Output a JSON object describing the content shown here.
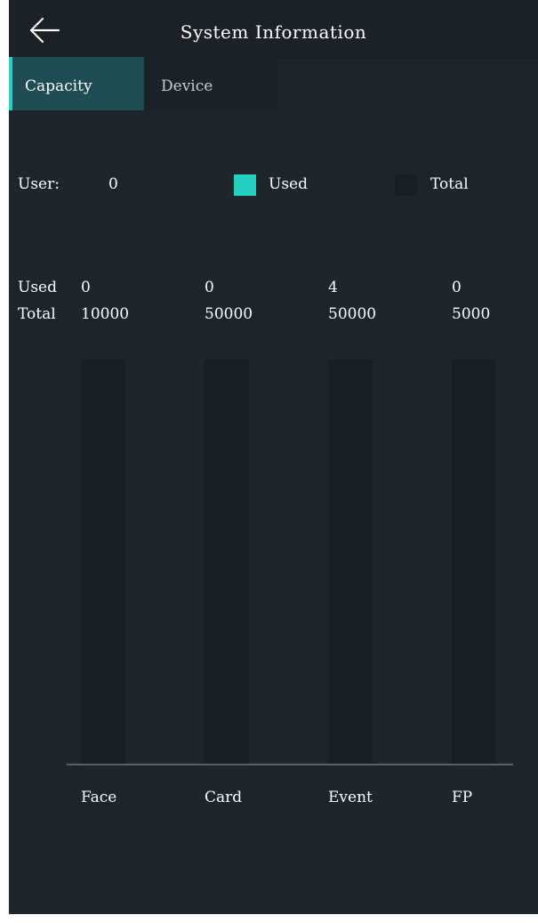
{
  "header": {
    "title": "System Information",
    "back_icon": "arrow-left-icon"
  },
  "tabs": [
    {
      "label": "Capacity",
      "active": true
    },
    {
      "label": "Device",
      "active": false
    }
  ],
  "user": {
    "label": "User:",
    "value": "0"
  },
  "legend": [
    {
      "label": "Used",
      "color": "#25d0c3"
    },
    {
      "label": "Total",
      "color": "#1a1f25"
    }
  ],
  "table": {
    "row_labels": {
      "used": "Used",
      "total": "Total"
    },
    "columns": [
      {
        "used": "0",
        "total": "10000"
      },
      {
        "used": "0",
        "total": "50000"
      },
      {
        "used": "4",
        "total": "50000"
      },
      {
        "used": "0",
        "total": "5000"
      }
    ]
  },
  "chart_data": {
    "type": "bar",
    "categories": [
      "Face",
      "Card",
      "Event",
      "FP"
    ],
    "series": [
      {
        "name": "Used",
        "values": [
          0,
          0,
          4,
          0
        ],
        "color": "#25d0c3"
      },
      {
        "name": "Total",
        "values": [
          10000,
          50000,
          50000,
          5000
        ],
        "color": "#1a1f25"
      }
    ],
    "normalized": true,
    "xlabel": "",
    "ylabel": ""
  }
}
